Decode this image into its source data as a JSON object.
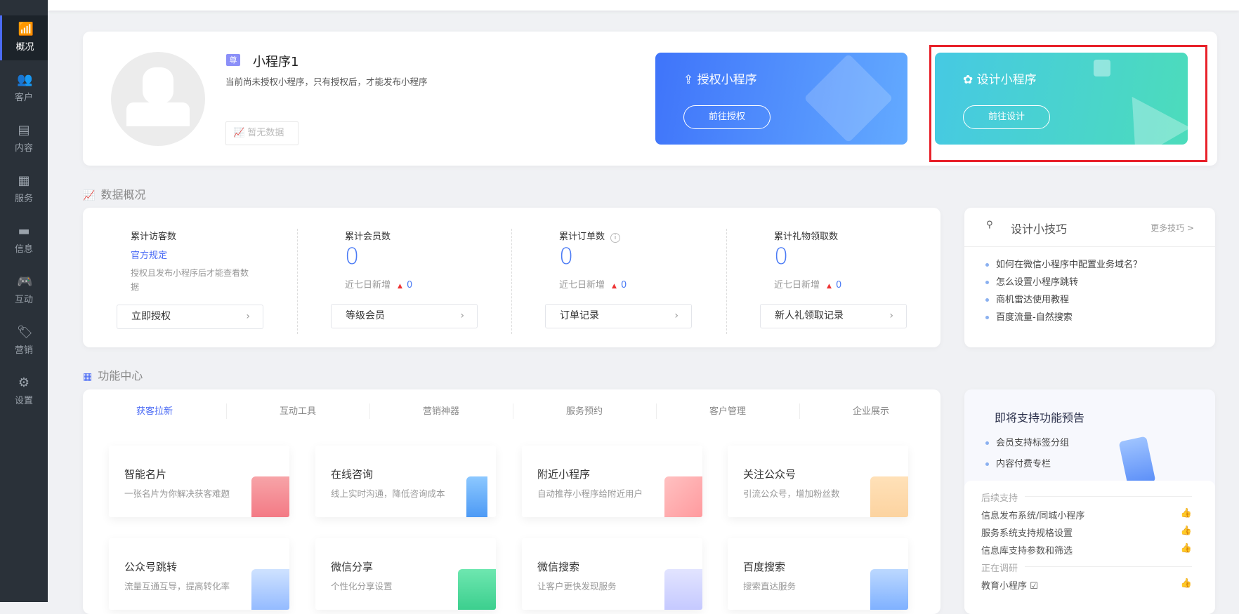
{
  "sidebar": {
    "items": [
      {
        "label": "概况",
        "icon": "chart-icon",
        "active": true
      },
      {
        "label": "客户",
        "icon": "customers-icon"
      },
      {
        "label": "内容",
        "icon": "document-icon"
      },
      {
        "label": "服务",
        "icon": "service-icon"
      },
      {
        "label": "信息",
        "icon": "message-icon"
      },
      {
        "label": "互动",
        "icon": "gamepad-icon"
      },
      {
        "label": "营销",
        "icon": "tag-icon"
      },
      {
        "label": "设置",
        "icon": "gear-icon"
      }
    ]
  },
  "profile": {
    "badge": "尊",
    "name": "小程序1",
    "desc": "当前尚未授权小程序，只有授权后，才能发布小程序",
    "no_data": "暂无数据"
  },
  "banners": {
    "auth": {
      "title": "授权小程序",
      "button": "前往授权",
      "color": "#4a7ef8"
    },
    "design": {
      "title": "设计小程序",
      "button": "前往设计",
      "color": "#47d0d8"
    }
  },
  "highlight_color": "#e8212a",
  "data_overview": {
    "title": "数据概况",
    "stats": [
      {
        "label": "累计访客数",
        "link": "官方规定",
        "note1": "授权且发布小程序后才能查看数",
        "note2": "据",
        "button": "立即授权"
      },
      {
        "label": "累计会员数",
        "value": "0",
        "inc_label": "近七日新增",
        "inc": "0",
        "button": "等级会员"
      },
      {
        "label": "累计订单数",
        "value": "0",
        "inc_label": "近七日新增",
        "inc": "0",
        "button": "订单记录"
      },
      {
        "label": "累计礼物领取数",
        "value": "0",
        "inc_label": "近七日新增",
        "inc": "0",
        "button": "新人礼领取记录"
      }
    ]
  },
  "tips": {
    "title": "设计小技巧",
    "more": "更多技巧 >",
    "items": [
      "如何在微信小程序中配置业务域名？",
      "怎么设置小程序跳转",
      "商机雷达使用教程",
      "百度流量-自然搜索"
    ]
  },
  "features": {
    "title": "功能中心",
    "tabs": [
      "获客拉新",
      "互动工具",
      "营销神器",
      "服务预约",
      "客户管理",
      "企业展示"
    ],
    "tiles": [
      {
        "title": "智能名片",
        "desc": "一张名片为你解决获客难题"
      },
      {
        "title": "在线咨询",
        "desc": "线上实时沟通，降低咨询成本"
      },
      {
        "title": "附近小程序",
        "desc": "自动推荐小程序给附近用户"
      },
      {
        "title": "关注公众号",
        "desc": "引流公众号，增加粉丝数"
      },
      {
        "title": "公众号跳转",
        "desc": "流量互通互导，提高转化率"
      },
      {
        "title": "微信分享",
        "desc": "个性化分享设置"
      },
      {
        "title": "微信搜索",
        "desc": "让客户更快发现服务"
      },
      {
        "title": "百度搜索",
        "desc": "搜索直达服务"
      }
    ]
  },
  "preview": {
    "title": "即将支持功能预告",
    "items": [
      "会员支持标签分组",
      "内容付费专栏"
    ],
    "later_label": "后续支持",
    "later": [
      "信息发布系统/同城小程序",
      "服务系统支持规格设置",
      "信息库支持参数和筛选"
    ],
    "research_label": "正在调研",
    "research": [
      "教育小程序"
    ]
  }
}
